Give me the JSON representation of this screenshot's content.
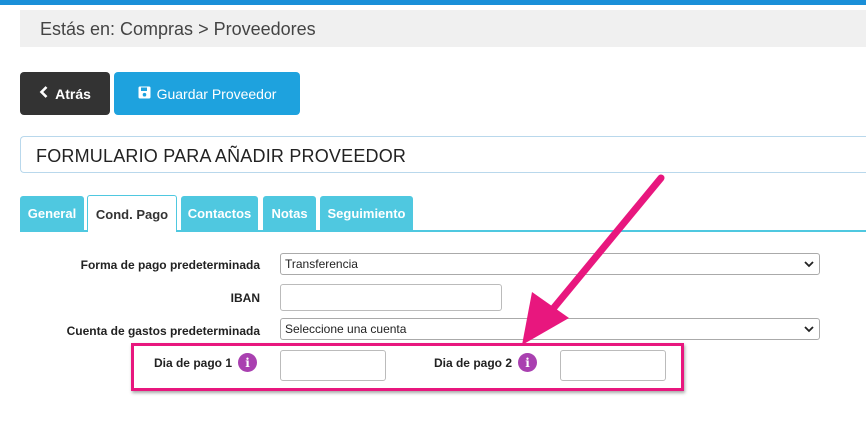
{
  "breadcrumb": {
    "text": "Estás en: Compras > Proveedores"
  },
  "toolbar": {
    "back_label": "Atrás",
    "save_label": "Guardar Proveedor"
  },
  "panel": {
    "title": "FORMULARIO PARA AÑADIR PROVEEDOR"
  },
  "tabs": [
    {
      "label": "General",
      "active": false
    },
    {
      "label": "Cond. Pago",
      "active": true
    },
    {
      "label": "Contactos",
      "active": false
    },
    {
      "label": "Notas",
      "active": false
    },
    {
      "label": "Seguimiento",
      "active": false
    }
  ],
  "form": {
    "payment_method": {
      "label": "Forma de pago predeterminada",
      "value": "Transferencia"
    },
    "iban": {
      "label": "IBAN",
      "value": ""
    },
    "expense_account": {
      "label": "Cuenta de gastos predeterminada",
      "value": "Seleccione una cuenta"
    },
    "pay_day_1": {
      "label": "Dia de pago 1",
      "value": ""
    },
    "pay_day_2": {
      "label": "Dia de pago 2",
      "value": ""
    },
    "info_glyph": "i"
  },
  "colors": {
    "accent": "#1ea2de",
    "tab": "#4fc8e0",
    "annotation": "#e8177e",
    "info": "#a940b0"
  }
}
